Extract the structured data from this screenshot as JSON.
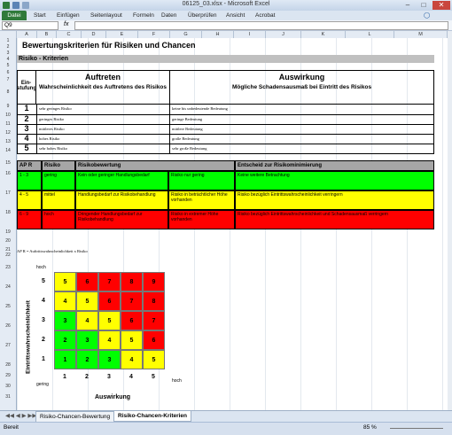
{
  "window": {
    "title": "06125_03.xlsx - Microsoft Excel"
  },
  "ribbon": {
    "tabs": [
      "Datei",
      "Start",
      "Einfügen",
      "Seitenlayout",
      "Formeln",
      "Daten",
      "Überprüfen",
      "Ansicht",
      "Acrobat"
    ]
  },
  "formula_bar": {
    "name_box": "Q9",
    "fx": "fx"
  },
  "columns": [
    "A",
    "B",
    "C",
    "D",
    "E",
    "F",
    "G",
    "H",
    "I",
    "J",
    "K",
    "L",
    "M"
  ],
  "rows": [
    "1",
    "2",
    "3",
    "4",
    "5",
    "6",
    "7",
    "8",
    "9",
    "10",
    "11",
    "12",
    "13",
    "14",
    "15",
    "16",
    "17",
    "18",
    "19",
    "20",
    "21",
    "22",
    "23",
    "24",
    "25",
    "26",
    "27",
    "28",
    "29",
    "30",
    "31"
  ],
  "sheet": {
    "title": "Bewertungskriterien für Risiken und Chancen",
    "band": "Risiko - Kriterien",
    "stufung_label": "Ein-stufung",
    "auftreten": {
      "title": "Auftreten",
      "subtitle": "Wahrscheinlichkeit des Auftretens des Risikos"
    },
    "auswirkung": {
      "title": "Auswirkung",
      "subtitle": "Mögliche Schadensausmaß bei Eintritt des Risikos"
    },
    "levels": [
      {
        "num": "1",
        "auftreten": "sehr geringes Risiko",
        "auswirkung": "keine bis unbedeutende Bedeutung"
      },
      {
        "num": "2",
        "auftreten": "geringes Risiko",
        "auswirkung": "geringe Bedeutung"
      },
      {
        "num": "3",
        "auftreten": "mittleres Risiko",
        "auswirkung": "mittlere Bedeutung"
      },
      {
        "num": "4",
        "auftreten": "hohes Risiko",
        "auswirkung": "große Bedeutung"
      },
      {
        "num": "5",
        "auftreten": "sehr hohes Risiko",
        "auswirkung": "sehr große Bedeutung"
      }
    ],
    "table2": {
      "headers": [
        "AP R",
        "Risiko",
        "Risikobewertung",
        "",
        "Entscheid zur Risikominimierung"
      ],
      "rows": [
        {
          "color": "#00ff00",
          "range": "1 - 3",
          "risiko": "gering",
          "bewertung": "Kein oder geringer Handlungsbedarf",
          "bewertung2": "Risiko nur gering",
          "entscheid": "Keine weitere Betrachtung"
        },
        {
          "color": "#ffff00",
          "range": "4 - 5",
          "risiko": "mittel",
          "bewertung": "Handlungsbedarf zur Risikobehandlung",
          "bewertung2": "Risiko in beträchtlicher Höhe vorhanden",
          "entscheid": "Risiko bezüglich Eintrittswahrscheinlichkeit verringern"
        },
        {
          "color": "#ff0000",
          "range": "6 - 9",
          "risiko": "hoch",
          "bewertung": "Dringender Handlungsbedarf zur Risikobehandlung",
          "bewertung2": "Risiko in extremer Höhe vorhanden",
          "entscheid": "Risiko bezüglich Eintrittswahrscheinlichkeit und Schadensausmaß verringern"
        }
      ]
    },
    "note": "AP R = Auftrittswahrscheinlichkeit x Risiko",
    "matrix": {
      "y_label": "Eintrittswahrscheinlichkeit",
      "x_label": "Auswirkung",
      "top_label": "hoch",
      "bottom_left_label": "gering",
      "right_label": "hoch",
      "y_ticks": [
        "5",
        "4",
        "3",
        "2",
        "1"
      ],
      "x_ticks": [
        "1",
        "2",
        "3",
        "4",
        "5"
      ],
      "cells": [
        [
          "5",
          "6",
          "7",
          "8",
          "9"
        ],
        [
          "4",
          "5",
          "6",
          "7",
          "8"
        ],
        [
          "3",
          "4",
          "5",
          "6",
          "7"
        ],
        [
          "2",
          "3",
          "4",
          "5",
          "6"
        ],
        [
          "1",
          "2",
          "3",
          "4",
          "5"
        ]
      ],
      "colors": [
        [
          "#ffff00",
          "#ff0000",
          "#ff0000",
          "#ff0000",
          "#ff0000"
        ],
        [
          "#ffff00",
          "#ffff00",
          "#ff0000",
          "#ff0000",
          "#ff0000"
        ],
        [
          "#00ff00",
          "#ffff00",
          "#ffff00",
          "#ff0000",
          "#ff0000"
        ],
        [
          "#00ff00",
          "#00ff00",
          "#ffff00",
          "#ffff00",
          "#ff0000"
        ],
        [
          "#00ff00",
          "#00ff00",
          "#00ff00",
          "#ffff00",
          "#ffff00"
        ]
      ]
    }
  },
  "sheet_tabs": [
    "Risiko-Chancen-Bewertung",
    "Risiko-Chancen-Kriterien"
  ],
  "status": {
    "left": "Bereit",
    "zoom": "85 %"
  }
}
